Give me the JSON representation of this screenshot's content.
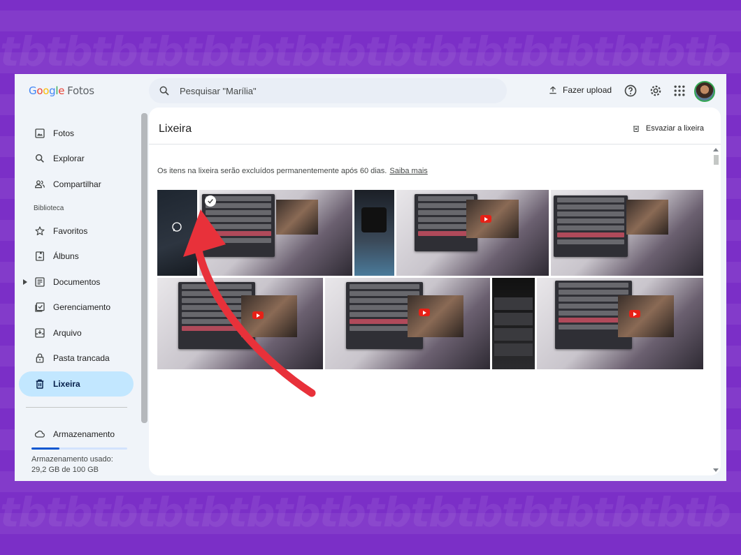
{
  "app": {
    "logo_google": [
      "G",
      "o",
      "o",
      "g",
      "l",
      "e"
    ],
    "logo_product": "Fotos"
  },
  "search": {
    "placeholder": "Pesquisar \"Marília\""
  },
  "header": {
    "upload_label": "Fazer upload"
  },
  "sidebar": {
    "items": [
      {
        "label": "Fotos",
        "icon": "photo-icon"
      },
      {
        "label": "Explorar",
        "icon": "search-icon"
      },
      {
        "label": "Compartilhar",
        "icon": "people-icon"
      }
    ],
    "library_label": "Biblioteca",
    "library_items": [
      {
        "label": "Favoritos",
        "icon": "star-icon"
      },
      {
        "label": "Álbuns",
        "icon": "album-icon"
      },
      {
        "label": "Documentos",
        "icon": "document-icon"
      },
      {
        "label": "Gerenciamento",
        "icon": "checklist-icon"
      },
      {
        "label": "Arquivo",
        "icon": "archive-icon"
      },
      {
        "label": "Pasta trancada",
        "icon": "lock-icon"
      },
      {
        "label": "Lixeira",
        "icon": "trash-icon",
        "active": true
      }
    ],
    "storage_label": "Armazenamento",
    "storage_used_label": "Armazenamento usado:",
    "storage_used_value": "29,2 GB de 100 GB",
    "storage_fraction": 0.292
  },
  "main": {
    "title": "Lixeira",
    "empty_trash_label": "Esvaziar a lixeira",
    "notice_text": "Os itens na lixeira serão excluídos permanentemente após 60 dias.",
    "notice_link": "Saiba mais"
  },
  "colors": {
    "accent": "#0b57d0",
    "active_nav": "#c2e7ff",
    "background_brand": "#7b2fc7",
    "annotation_arrow": "#e8313a"
  }
}
